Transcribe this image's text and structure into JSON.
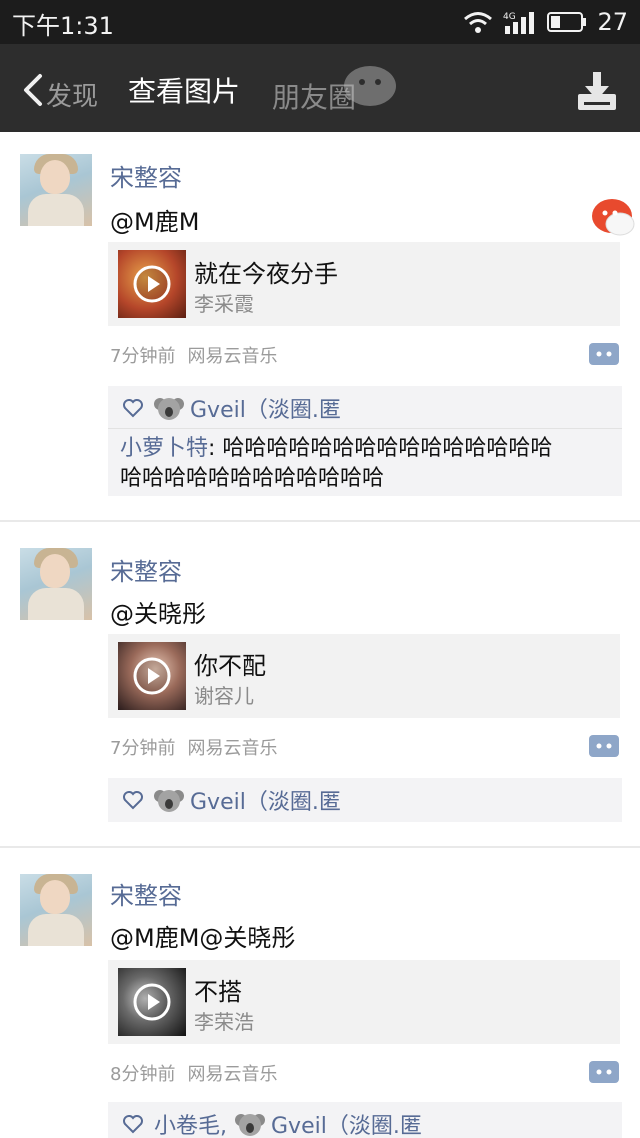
{
  "status_bar": {
    "time": "下午1:31",
    "network": "4G",
    "battery": "27"
  },
  "nav": {
    "back_label": "发现",
    "title": "查看图片",
    "faded_label": "朋友圈"
  },
  "posts": [
    {
      "username": "宋整容",
      "text": "@M鹿M",
      "song": {
        "title": "就在今夜分手",
        "artist": "李采霞"
      },
      "time": "7分钟前",
      "source": "网易云音乐",
      "likes": "Gveil（淡圈.匿",
      "comments": [
        {
          "author": "小萝卜特",
          "line1": ": 哈哈哈哈哈哈哈哈哈哈哈哈哈哈哈",
          "line2": "哈哈哈哈哈哈哈哈哈哈哈哈"
        }
      ]
    },
    {
      "username": "宋整容",
      "text": "@关晓彤",
      "song": {
        "title": "你不配",
        "artist": "谢容儿"
      },
      "time": "7分钟前",
      "source": "网易云音乐",
      "likes": "Gveil（淡圈.匿"
    },
    {
      "username": "宋整容",
      "text": "@M鹿M@关晓彤",
      "song": {
        "title": "不搭",
        "artist": "李荣浩"
      },
      "time": "8分钟前",
      "source": "网易云音乐",
      "likes_prefix": "小卷毛,",
      "likes": "Gveil（淡圈.匿"
    }
  ],
  "colors": {
    "link_blue": "#576b95",
    "status_bg": "#1c1c1c",
    "nav_bg": "#2d2d2d"
  }
}
